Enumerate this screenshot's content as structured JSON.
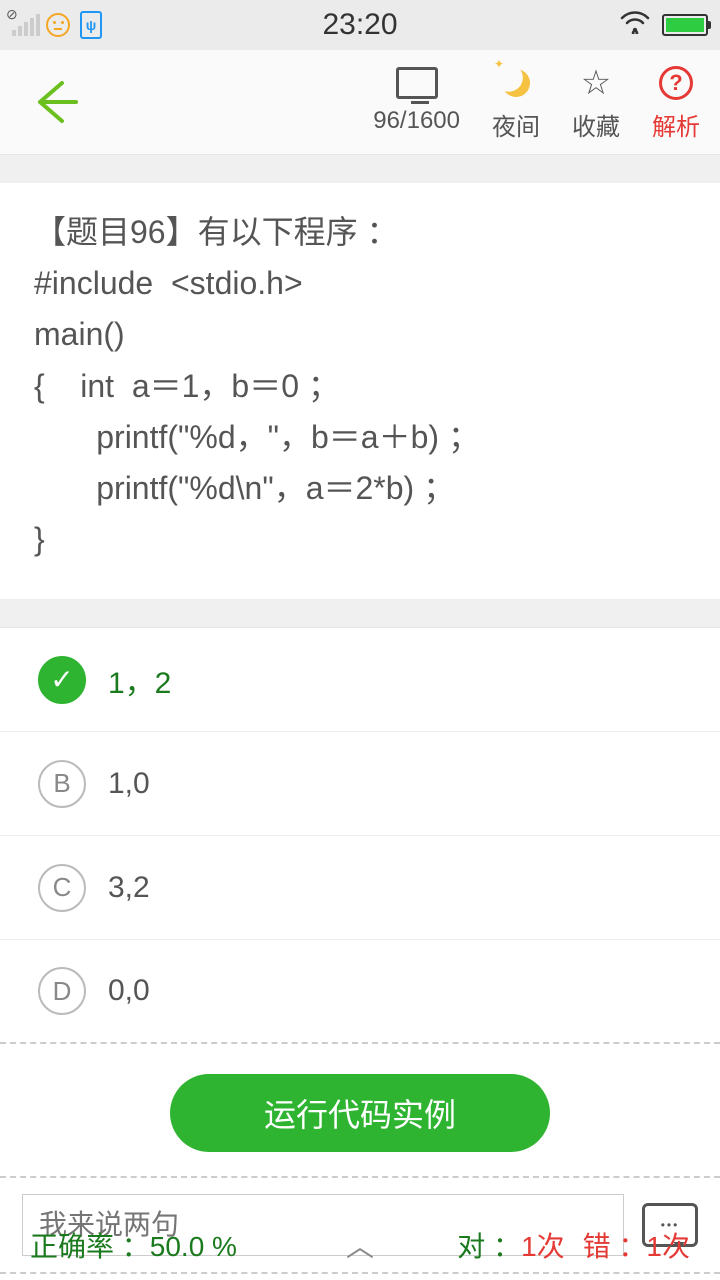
{
  "status": {
    "time": "23:20",
    "usb_glyph": "ψ"
  },
  "toolbar": {
    "progress": "96/1600",
    "night": "夜间",
    "favorite": "收藏",
    "analysis": "解析"
  },
  "question": {
    "text": "【题目96】有以下程序 ：\n#include  <stdio.h>\nmain()\n{    int  a＝1，b＝0 ；\n       printf(\"%d，\"，b＝a＋b) ；\n       printf(\"%d\\n\"，a＝2*b) ；\n}"
  },
  "options": [
    {
      "letter": "✓",
      "text": "1，2",
      "selected": true
    },
    {
      "letter": "B",
      "text": "1,0",
      "selected": false
    },
    {
      "letter": "C",
      "text": "3,2",
      "selected": false
    },
    {
      "letter": "D",
      "text": "0,0",
      "selected": false
    }
  ],
  "run_label": "运行代码实例",
  "comment_placeholder": "我来说两句",
  "chat_dots": "•••",
  "footer": {
    "rate_label": "正确率 ：",
    "rate_value": "50.0 %",
    "correct_label": "对 ：",
    "correct_value": "1次",
    "wrong_label": "错 ：",
    "wrong_value": "1次",
    "caret": "︿"
  }
}
